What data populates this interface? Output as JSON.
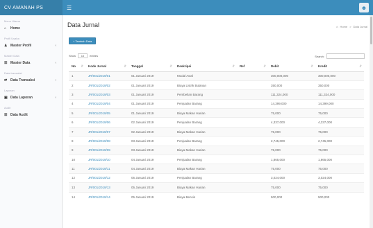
{
  "header": {
    "brand": "CV AMANAH PS",
    "menu_icon": "hamburger-icon",
    "user_icon": "user-avatar-icon"
  },
  "sidebar": {
    "items": [
      {
        "section": "Menu Utama",
        "label": "Home",
        "icon": "home-icon",
        "has_children": false
      },
      {
        "section": "Profil Usaha",
        "label": "Master Profil",
        "icon": "user-icon",
        "has_children": true
      },
      {
        "section": "Master Data",
        "label": "Master Data",
        "icon": "list-icon",
        "has_children": true
      },
      {
        "section": "Data transaksi",
        "label": "Data Transaksi",
        "icon": "exchange-icon",
        "has_children": true
      },
      {
        "section": "Laporan",
        "label": "Data Laporan",
        "icon": "folder-icon",
        "has_children": true
      },
      {
        "section": "Audit",
        "label": "Data Audit",
        "icon": "audit-icon",
        "has_children": false
      }
    ]
  },
  "main": {
    "title": "Data Jurnal",
    "breadcrumb": {
      "home": "Home",
      "current": "Data Jurnal"
    },
    "add_button": "+ Tambah Data",
    "length": {
      "show": "Show",
      "value": "10",
      "entries": "entries"
    },
    "search_label": "Search:"
  },
  "table": {
    "headers": [
      "No",
      "Kode Jurnal",
      "Tanggal",
      "Deskripsi",
      "Ref",
      "Debit",
      "Kredit"
    ],
    "rows": [
      [
        "1",
        "JR/001/2019/01",
        "01 Januari 2019",
        "Modal Awal",
        "",
        "300,000,000",
        "300,000,000"
      ],
      [
        "2",
        "JR/001/2019/02",
        "01 Januari 2019",
        "Biaya Listrik Bulanan",
        "",
        "350,000",
        "350,000"
      ],
      [
        "3",
        "JR/001/2019/03",
        "01 Januari 2019",
        "Pembelian Barang",
        "",
        "111,324,000",
        "111,324,000"
      ],
      [
        "4",
        "JR/001/2019/04",
        "01 Januari 2019",
        "Penjualan Barang",
        "",
        "14,399,000",
        "14,399,000"
      ],
      [
        "5",
        "JR/001/2019/05",
        "01 Januari 2019",
        "Biaya Makan Harian",
        "",
        "75,000",
        "75,000"
      ],
      [
        "6",
        "JR/001/2019/06",
        "02 Januari 2019",
        "Penjualan Barang",
        "",
        "4,337,000",
        "4,337,000"
      ],
      [
        "7",
        "JR/001/2019/07",
        "02 Januari 2019",
        "Biaya Makan Harian",
        "",
        "75,000",
        "75,000"
      ],
      [
        "8",
        "JR/001/2019/08",
        "03 Januari 2019",
        "Penjualan Barang",
        "",
        "2,745,000",
        "2,745,000"
      ],
      [
        "9",
        "JR/001/2019/09",
        "03 Januari 2019",
        "Biaya Makan Harian",
        "",
        "75,000",
        "75,000"
      ],
      [
        "10",
        "JR/001/2019/10",
        "04 Januari 2019",
        "Penjualan Barang",
        "",
        "1,865,000",
        "1,865,000"
      ],
      [
        "11",
        "JR/001/2019/11",
        "04 Januari 2019",
        "Biaya Makan Harian",
        "",
        "75,000",
        "75,000"
      ],
      [
        "12",
        "JR/001/2019/12",
        "05 Januari 2019",
        "Penjualan Barang",
        "",
        "3,024,000",
        "3,024,000"
      ],
      [
        "13",
        "JR/001/2019/13",
        "05 Januari 2019",
        "Biaya Makan Harian",
        "",
        "75,000",
        "75,000"
      ],
      [
        "14",
        "JR/001/2019/14",
        "05 Januari 2019",
        "Biaya Bensin",
        "",
        "500,000",
        "500,000"
      ]
    ]
  }
}
